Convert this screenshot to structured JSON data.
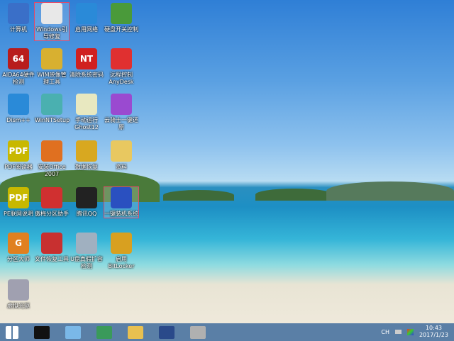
{
  "desktop": {
    "icons": [
      {
        "label": "计算机",
        "icon": "computer-icon",
        "color": "#3a6fc8"
      },
      {
        "label": "Windows引导修复",
        "icon": "first-aid-kit-icon",
        "color": "#e8e8e8",
        "selected": true
      },
      {
        "label": "启用网络",
        "icon": "globe-icon",
        "color": "#2a8ad8"
      },
      {
        "label": "硬盘开关控制",
        "icon": "blocks-icon",
        "color": "#4a9a3a"
      },
      {
        "label": "AIDA64硬件检测",
        "icon": "aida64-icon",
        "color": "#b81c1c",
        "glyph": "64"
      },
      {
        "label": "WIM映像管理工具",
        "icon": "wim-icon",
        "color": "#d8b030"
      },
      {
        "label": "清除系统密码",
        "icon": "nt-key-icon",
        "color": "#d02020",
        "glyph": "NT"
      },
      {
        "label": "远程控制AnyDesk",
        "icon": "anydesk-icon",
        "color": "#e03030"
      },
      {
        "label": "Dism++",
        "icon": "gears-icon",
        "color": "#2a8ad8"
      },
      {
        "label": "WinNTSetup",
        "icon": "setup-icon",
        "color": "#4ab0b0"
      },
      {
        "label": "手动运行Ghost12",
        "icon": "ghost-icon",
        "color": "#e8e8c0"
      },
      {
        "label": "云骑士一键还原",
        "icon": "pinwheel-icon",
        "color": "#9a4ad0"
      },
      {
        "label": "PDF阅读器",
        "icon": "pdf-icon",
        "color": "#c8b800",
        "glyph": "PDF"
      },
      {
        "label": "安装Office 2007",
        "icon": "office-icon",
        "color": "#e07020"
      },
      {
        "label": "数据恢复",
        "icon": "data-recovery-icon",
        "color": "#d8a820"
      },
      {
        "label": "资料",
        "icon": "folder-icon",
        "color": "#e8c860"
      },
      {
        "label": "PE联网说明",
        "icon": "pdf-icon",
        "color": "#c8b800",
        "glyph": "PDF"
      },
      {
        "label": "傲梅分区助手",
        "icon": "partition-icon",
        "color": "#d03030"
      },
      {
        "label": "腾讯QQ",
        "icon": "qq-icon",
        "color": "#222222"
      },
      {
        "label": "一键装机系统",
        "icon": "install-system-icon",
        "color": "#2a50c0",
        "selected": true
      },
      {
        "label": "分区大师",
        "icon": "diskgenius-icon",
        "color": "#e08020",
        "glyph": "G"
      },
      {
        "label": "文件恢复工具",
        "icon": "recovery-icon",
        "color": "#c83030"
      },
      {
        "label": "U盘真假扩容检测",
        "icon": "magnifier-icon",
        "color": "#a0b0c0"
      },
      {
        "label": "启用BitLocker",
        "icon": "bitlocker-icon",
        "color": "#d8a020"
      },
      {
        "label": "虚拟光驱",
        "icon": "virtual-drive-icon",
        "color": "#a0a0b0"
      }
    ]
  },
  "taskbar": {
    "items": [
      {
        "icon": "start-icon",
        "color": "#ffffff"
      },
      {
        "icon": "cmd-icon",
        "color": "#111111"
      },
      {
        "icon": "notepad-icon",
        "color": "#7ab8e8"
      },
      {
        "icon": "registry-icon",
        "color": "#3a9a5a"
      },
      {
        "icon": "explorer-icon",
        "color": "#e8c050"
      },
      {
        "icon": "screen-icon",
        "color": "#2a4a8a"
      },
      {
        "icon": "drive-icon",
        "color": "#b0b0b0"
      }
    ],
    "lang": "CH",
    "time": "10:43",
    "date": "2017/1/23"
  }
}
